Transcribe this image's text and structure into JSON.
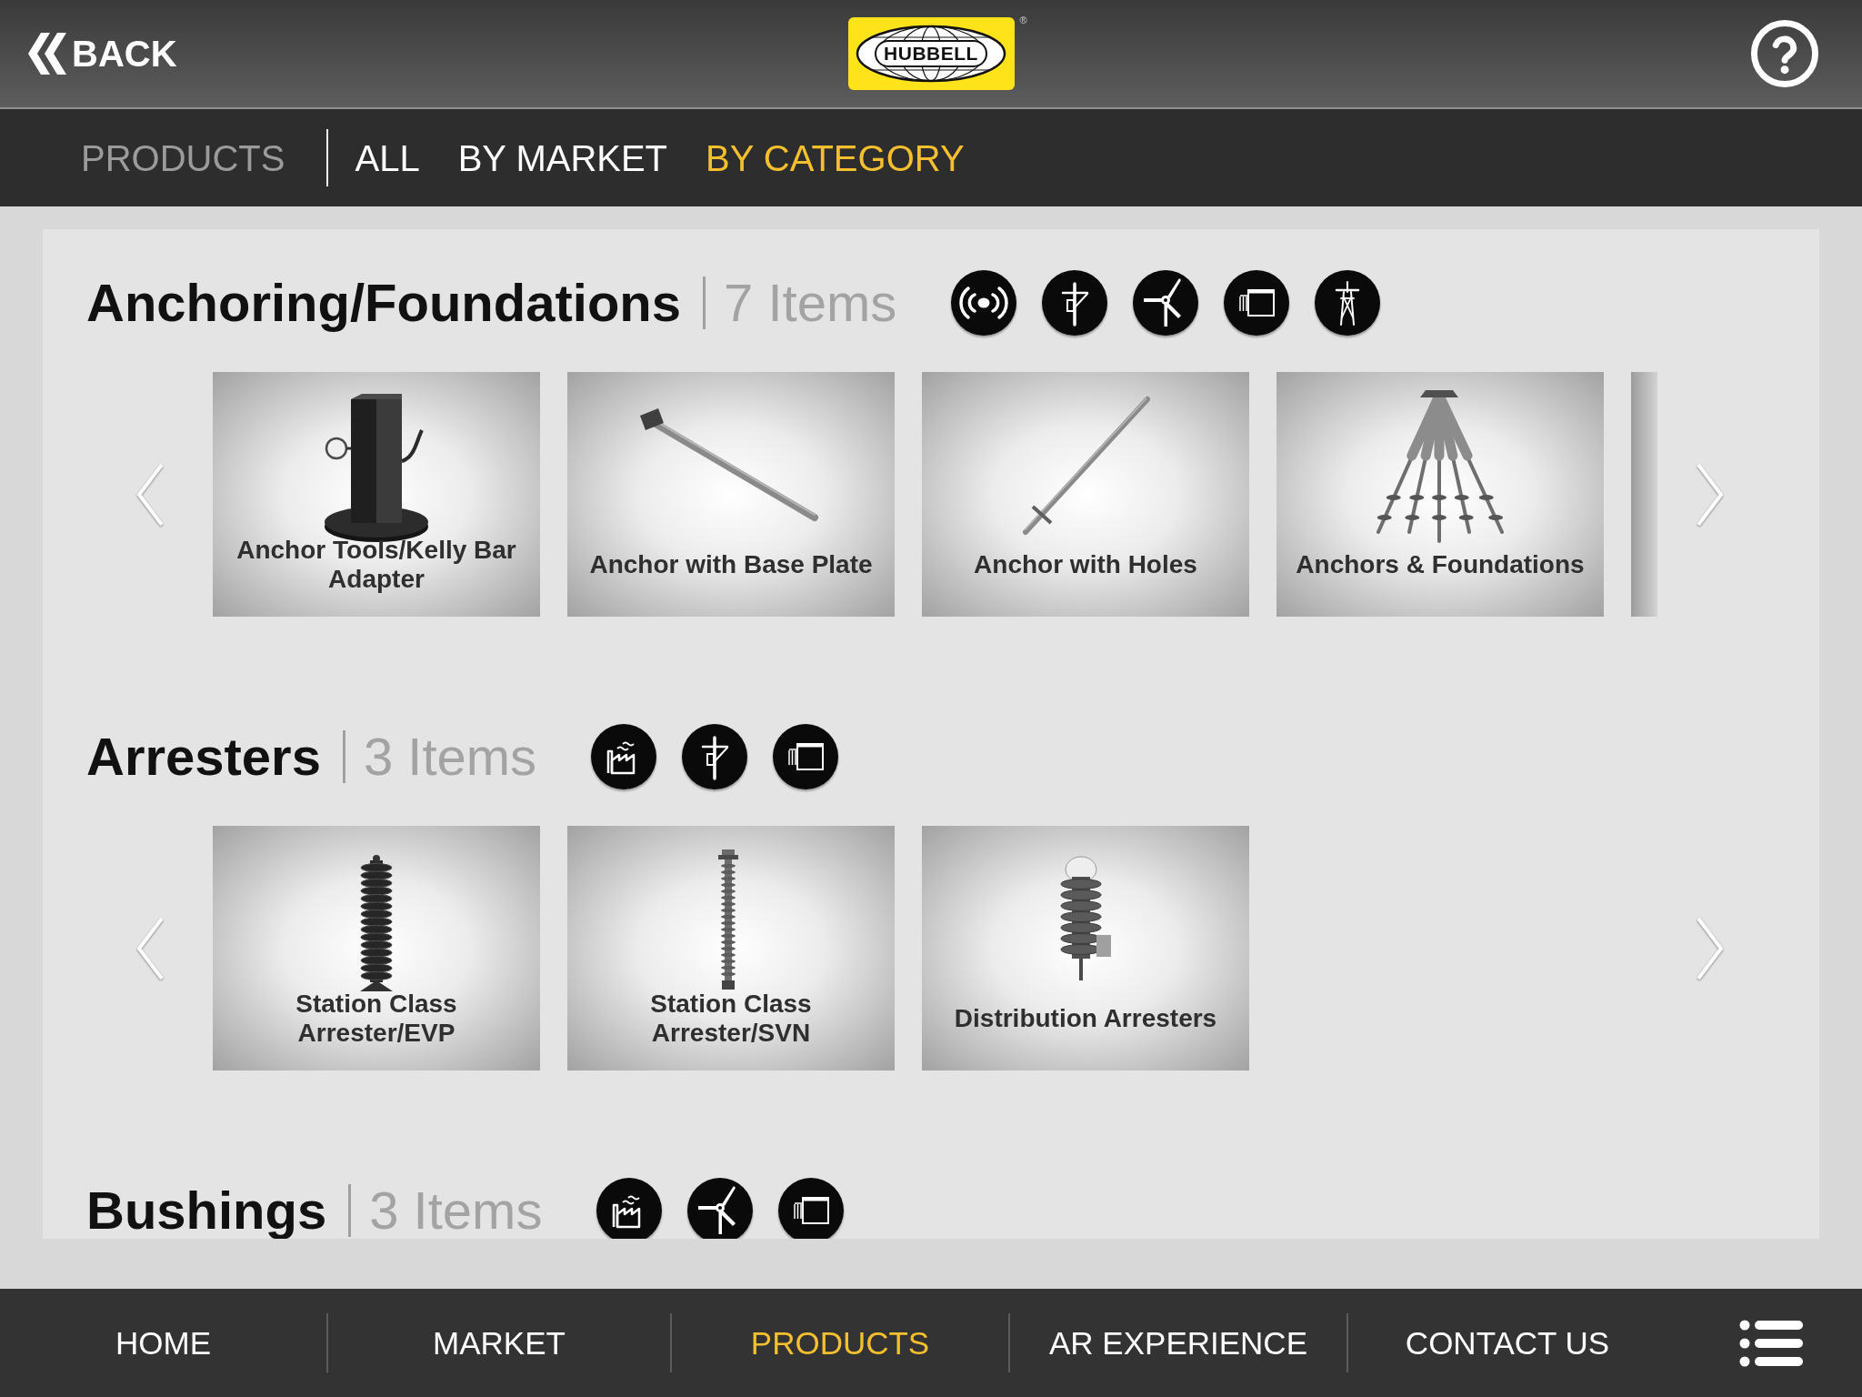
{
  "header": {
    "back": {
      "label": "BACK"
    },
    "logo": {
      "text": "HUBBELL",
      "mark": "®"
    }
  },
  "subnav": {
    "label": "PRODUCTS",
    "tabs": [
      {
        "label": "ALL",
        "selected": false
      },
      {
        "label": "BY MARKET",
        "selected": false
      },
      {
        "label": "BY CATEGORY",
        "selected": true
      }
    ]
  },
  "sections": [
    {
      "title": "Anchoring/Foundations",
      "count": "7 Items",
      "markets": [
        {
          "kind": "broadcast"
        },
        {
          "kind": "utility-pole"
        },
        {
          "kind": "wind-turbine"
        },
        {
          "kind": "window"
        },
        {
          "kind": "transmission-tower"
        }
      ],
      "products": [
        {
          "label": "Anchor Tools/Kelly Bar\nAdapter",
          "kind": "adapter"
        },
        {
          "label": "Anchor with Base Plate",
          "kind": "rod-plate"
        },
        {
          "label": "Anchor with Holes",
          "kind": "rod"
        },
        {
          "label": "Anchors & Foundations",
          "kind": "helix-cluster"
        }
      ],
      "more_tiles": true
    },
    {
      "title": "Arresters",
      "count": "3 Items",
      "markets": [
        {
          "kind": "factory"
        },
        {
          "kind": "utility-pole"
        },
        {
          "kind": "window"
        }
      ],
      "products": [
        {
          "label": "Station Class\nArrester/EVP",
          "kind": "arrester-tall"
        },
        {
          "label": "Station Class\nArrester/SVN",
          "kind": "arrester-slim"
        },
        {
          "label": "Distribution Arresters",
          "kind": "arrester-short"
        }
      ]
    },
    {
      "title": "Bushings",
      "count": "3 Items",
      "markets": [
        {
          "kind": "factory"
        },
        {
          "kind": "wind-turbine"
        },
        {
          "kind": "window"
        }
      ]
    }
  ],
  "nav": {
    "items": [
      {
        "label": "HOME",
        "selected": false
      },
      {
        "label": "MARKET",
        "selected": false
      },
      {
        "label": "PRODUCTS",
        "selected": true
      },
      {
        "label": "AR EXPERIENCE",
        "selected": false
      },
      {
        "label": "CONTACT US",
        "selected": false
      }
    ]
  }
}
